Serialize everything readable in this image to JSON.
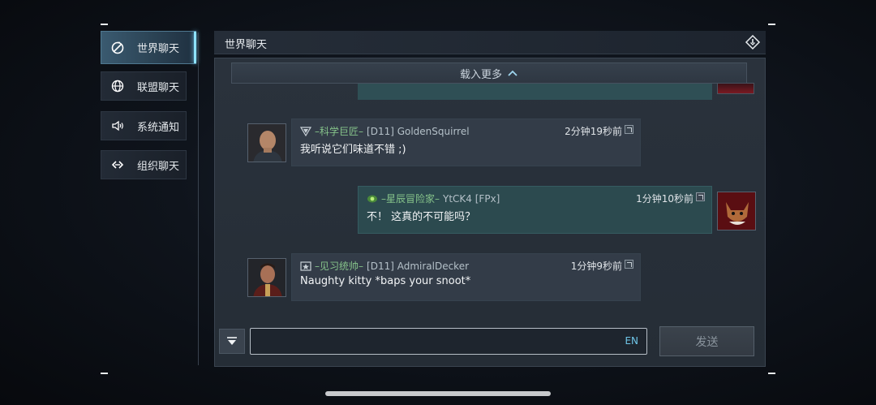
{
  "sidebar": {
    "items": [
      {
        "label": "世界聊天",
        "icon": "world-chat-icon",
        "active": true
      },
      {
        "label": "联盟聊天",
        "icon": "globe-icon",
        "active": false
      },
      {
        "label": "系统通知",
        "icon": "speaker-icon",
        "active": false
      },
      {
        "label": "组织聊天",
        "icon": "link-icon",
        "active": false
      }
    ]
  },
  "header": {
    "title": "世界聊天",
    "exit_icon": "exit-icon"
  },
  "load_more": {
    "label": "载入更多"
  },
  "messages": [
    {
      "side": "left",
      "rank": "–科学巨匠–",
      "user": "[D11] GoldenSquirrel",
      "time": "2分钟19秒前",
      "text": "我听说它们味道不错 ;)"
    },
    {
      "side": "right",
      "rank": "–星辰冒险家–",
      "user": "YtCK4 [FPx]",
      "time": "1分钟10秒前",
      "text": "不！ 这真的不可能吗？"
    },
    {
      "side": "left",
      "rank": "–见习统帅–",
      "user": "[D11] AdmiralDecker",
      "time": "1分钟9秒前",
      "text": "Naughty kitty *baps your snoot*"
    }
  ],
  "input": {
    "value": "",
    "lang": "EN"
  },
  "send": {
    "label": "发送"
  },
  "colors": {
    "accent": "#8ee3ff",
    "rank_green": "#86c38a",
    "lang_blue": "#6fc6e8"
  }
}
